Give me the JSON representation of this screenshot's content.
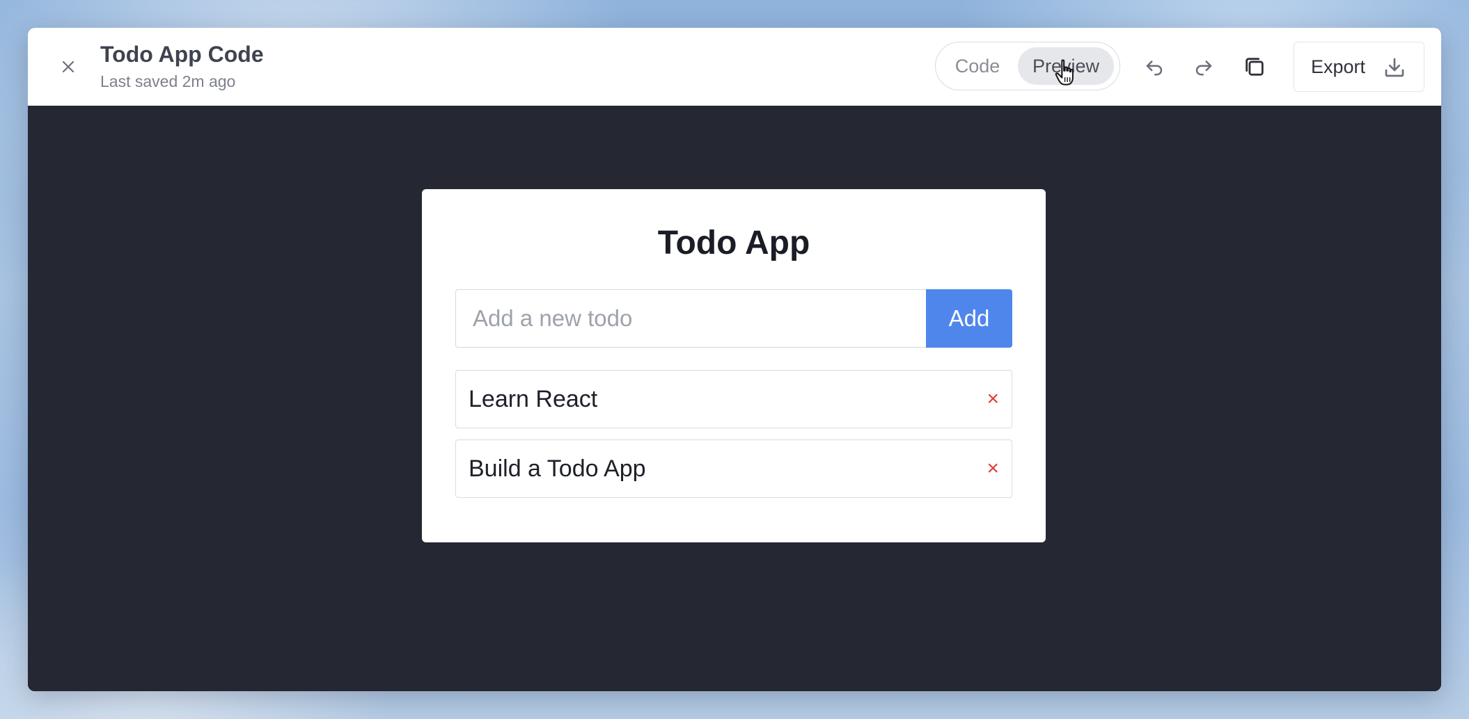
{
  "window": {
    "title": "Todo App Code",
    "subtitle": "Last saved 2m ago"
  },
  "toolbar": {
    "view_toggle": {
      "options": [
        "Code",
        "Preview"
      ],
      "selected": "Preview"
    },
    "export_label": "Export"
  },
  "icons": {
    "close": "close-icon",
    "undo": "undo-icon",
    "redo": "redo-icon",
    "copy": "copy-icon",
    "export": "download-icon",
    "cursor": "hand-pointer-icon"
  },
  "preview": {
    "app_title": "Todo App",
    "input_placeholder": "Add a new todo",
    "input_value": "",
    "add_label": "Add",
    "todos": [
      {
        "text": "Learn React",
        "delete_symbol": "×"
      },
      {
        "text": "Build a Todo App",
        "delete_symbol": "×"
      }
    ]
  },
  "colors": {
    "canvas_bg": "#252733",
    "accent": "#4f86ec",
    "delete": "#e23b3b"
  }
}
